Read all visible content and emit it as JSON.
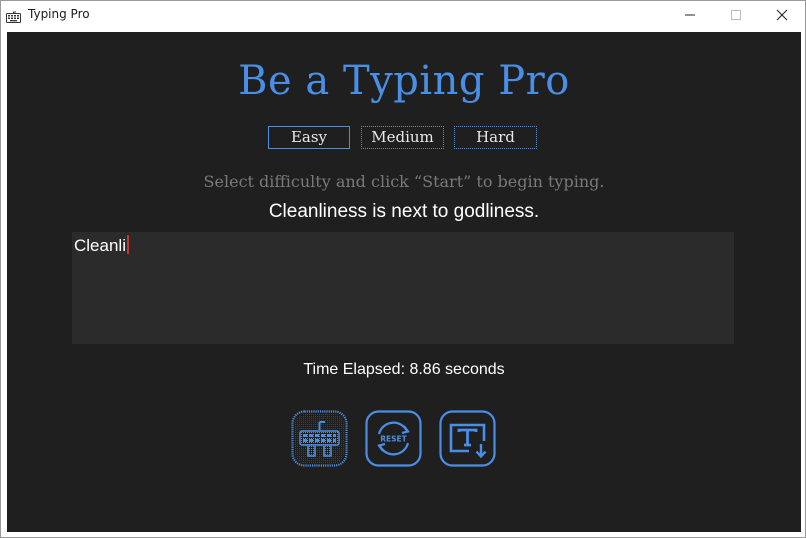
{
  "window": {
    "title": "Typing Pro",
    "icon": "keyboard-icon"
  },
  "colors": {
    "accent": "#4a8fe7",
    "background": "#1f1f1f",
    "input_background": "#2b2b2b",
    "instruction_text": "#7a7a7a",
    "caret": "#c0392b"
  },
  "main": {
    "heading": "Be a Typing Pro",
    "difficulty": {
      "options": [
        "Easy",
        "Medium",
        "Hard"
      ],
      "selected": "Easy"
    },
    "instruction": "Select difficulty and click “Start” to begin typing.",
    "target_sentence": "Cleanliness is next to godliness.",
    "typed_text": "Cleanli",
    "timer_text": "Time Elapsed: 8.86 seconds",
    "toolbar": {
      "start_icon": "keyboard-start-icon",
      "reset_icon": "reset-icon",
      "reset_label": "RESET",
      "save_icon": "text-download-icon"
    }
  }
}
